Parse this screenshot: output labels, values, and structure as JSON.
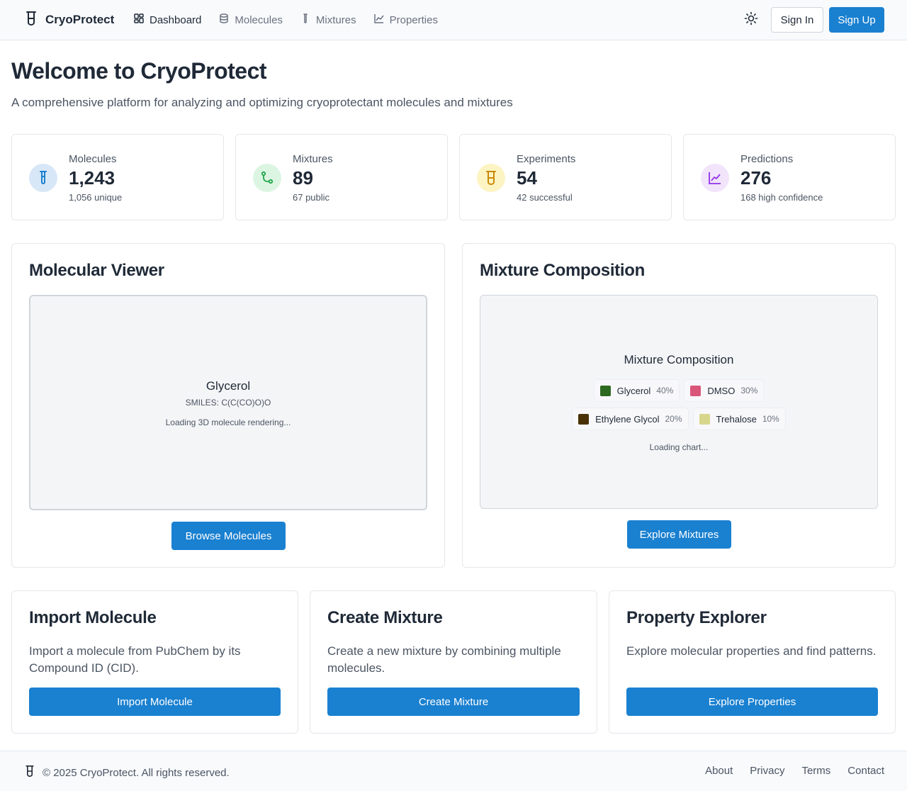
{
  "header": {
    "brand": "CryoProtect",
    "nav": [
      {
        "label": "Dashboard",
        "icon": "dashboard-icon",
        "active": true
      },
      {
        "label": "Molecules",
        "icon": "database-icon"
      },
      {
        "label": "Mixtures",
        "icon": "test-tube-icon"
      },
      {
        "label": "Properties",
        "icon": "line-chart-icon"
      }
    ],
    "sign_in": "Sign In",
    "sign_up": "Sign Up"
  },
  "hero": {
    "title": "Welcome to CryoProtect",
    "subtitle": "A comprehensive platform for analyzing and optimizing cryoprotectant molecules and mixtures"
  },
  "stats": [
    {
      "label": "Molecules",
      "value": "1,243",
      "sub": "1,056 unique",
      "icon": "test-tube-icon",
      "color": "#1a80d0"
    },
    {
      "label": "Mixtures",
      "value": "89",
      "sub": "67 public",
      "icon": "git-merge-icon",
      "color": "#22a64a"
    },
    {
      "label": "Experiments",
      "value": "54",
      "sub": "42 successful",
      "icon": "beaker-icon",
      "color": "#ca8a04"
    },
    {
      "label": "Predictions",
      "value": "276",
      "sub": "168 high confidence",
      "icon": "line-chart-icon",
      "color": "#9333ea"
    }
  ],
  "viewer": {
    "title": "Molecular Viewer",
    "molecule_name": "Glycerol",
    "smiles": "SMILES: C(C(CO)O)O",
    "loading": "Loading 3D molecule rendering...",
    "button": "Browse Molecules"
  },
  "mixture": {
    "title": "Mixture Composition",
    "chart_title": "Mixture Composition",
    "components": [
      {
        "name": "Glycerol",
        "pct": "40%",
        "color": "#2d6a1f"
      },
      {
        "name": "DMSO",
        "pct": "30%",
        "color": "#d9557a"
      },
      {
        "name": "Ethylene Glycol",
        "pct": "20%",
        "color": "#4a3206"
      },
      {
        "name": "Trehalose",
        "pct": "10%",
        "color": "#d8d68c"
      }
    ],
    "loading": "Loading chart...",
    "button": "Explore Mixtures"
  },
  "actions": [
    {
      "title": "Import Molecule",
      "desc": "Import a molecule from PubChem by its Compound ID (CID).",
      "button": "Import Molecule"
    },
    {
      "title": "Create Mixture",
      "desc": "Create a new mixture by combining multiple molecules.",
      "button": "Create Mixture"
    },
    {
      "title": "Property Explorer",
      "desc": "Explore molecular properties and find patterns.",
      "button": "Explore Properties"
    }
  ],
  "footer": {
    "copyright": "© 2025 CryoProtect. All rights reserved.",
    "links": [
      "About",
      "Privacy",
      "Terms",
      "Contact"
    ]
  }
}
